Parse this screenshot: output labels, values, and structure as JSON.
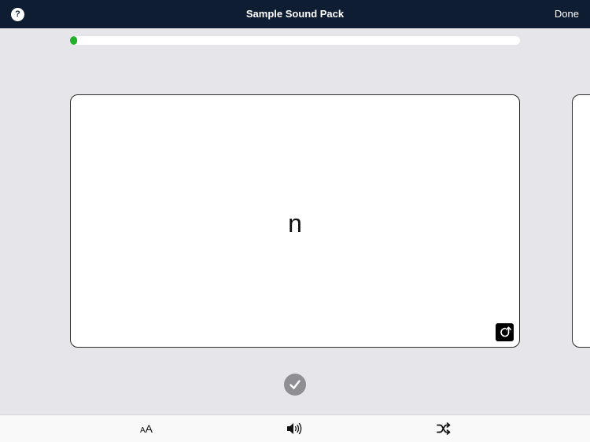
{
  "navbar": {
    "help_label": "?",
    "title": "Sample Sound Pack",
    "done_label": "Done"
  },
  "progress": {
    "fraction": 0.015,
    "color": "#22b12a"
  },
  "card": {
    "text": "n",
    "flip_icon": "flip-card-icon"
  },
  "check": {
    "icon": "checkmark-icon"
  },
  "toolbar": {
    "font_size_small": "A",
    "font_size_large": "A",
    "sound_icon": "speaker-icon",
    "shuffle_icon": "shuffle-icon"
  },
  "colors": {
    "navbar_bg": "#0f1d33",
    "background": "#e5e5ea",
    "accent_green": "#22b12a",
    "check_gray": "#8e8e93"
  }
}
